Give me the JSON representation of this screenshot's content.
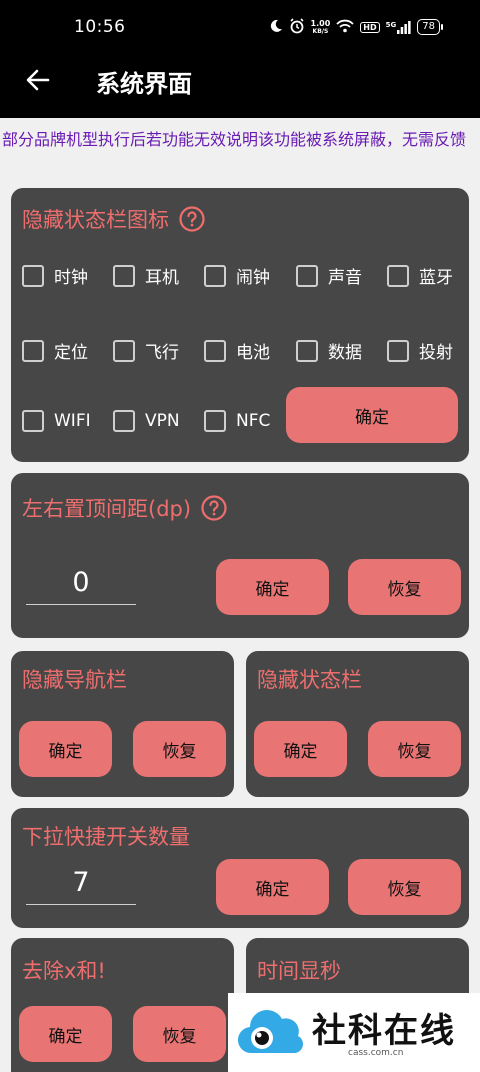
{
  "status": {
    "time": "10:56",
    "net_speed_value": "1.00",
    "net_speed_unit": "KB/S",
    "hd": "HD",
    "signal": "5G",
    "battery": "78"
  },
  "appbar": {
    "title": "系统界面"
  },
  "notice": "部分品牌机型执行后若功能无效说明该功能被系统屏蔽，无需反馈",
  "hide_status_icons": {
    "title": "隐藏状态栏图标",
    "items": [
      "时钟",
      "耳机",
      "闹钟",
      "声音",
      "蓝牙",
      "定位",
      "飞行",
      "电池",
      "数据",
      "投射",
      "WIFI",
      "VPN",
      "NFC"
    ],
    "confirm": "确定"
  },
  "padding": {
    "title": "左右置顶间距(dp)",
    "value": "0",
    "confirm": "确定",
    "restore": "恢复"
  },
  "hide_nav": {
    "title": "隐藏导航栏",
    "confirm": "确定",
    "restore": "恢复"
  },
  "hide_status": {
    "title": "隐藏状态栏",
    "confirm": "确定",
    "restore": "恢复"
  },
  "quick_tiles": {
    "title": "下拉快捷开关数量",
    "value": "7",
    "confirm": "确定",
    "restore": "恢复"
  },
  "remove_x": {
    "title": "去除x和!",
    "confirm": "确定",
    "restore": "恢复"
  },
  "show_seconds": {
    "title": "时间显秒"
  },
  "watermark": {
    "brand": "社科在线",
    "domain": "cass.com.cn"
  },
  "colors": {
    "accent": "#ee6e6e",
    "button": "#e87474",
    "card": "#474747",
    "notice": "#6a1bb3"
  }
}
